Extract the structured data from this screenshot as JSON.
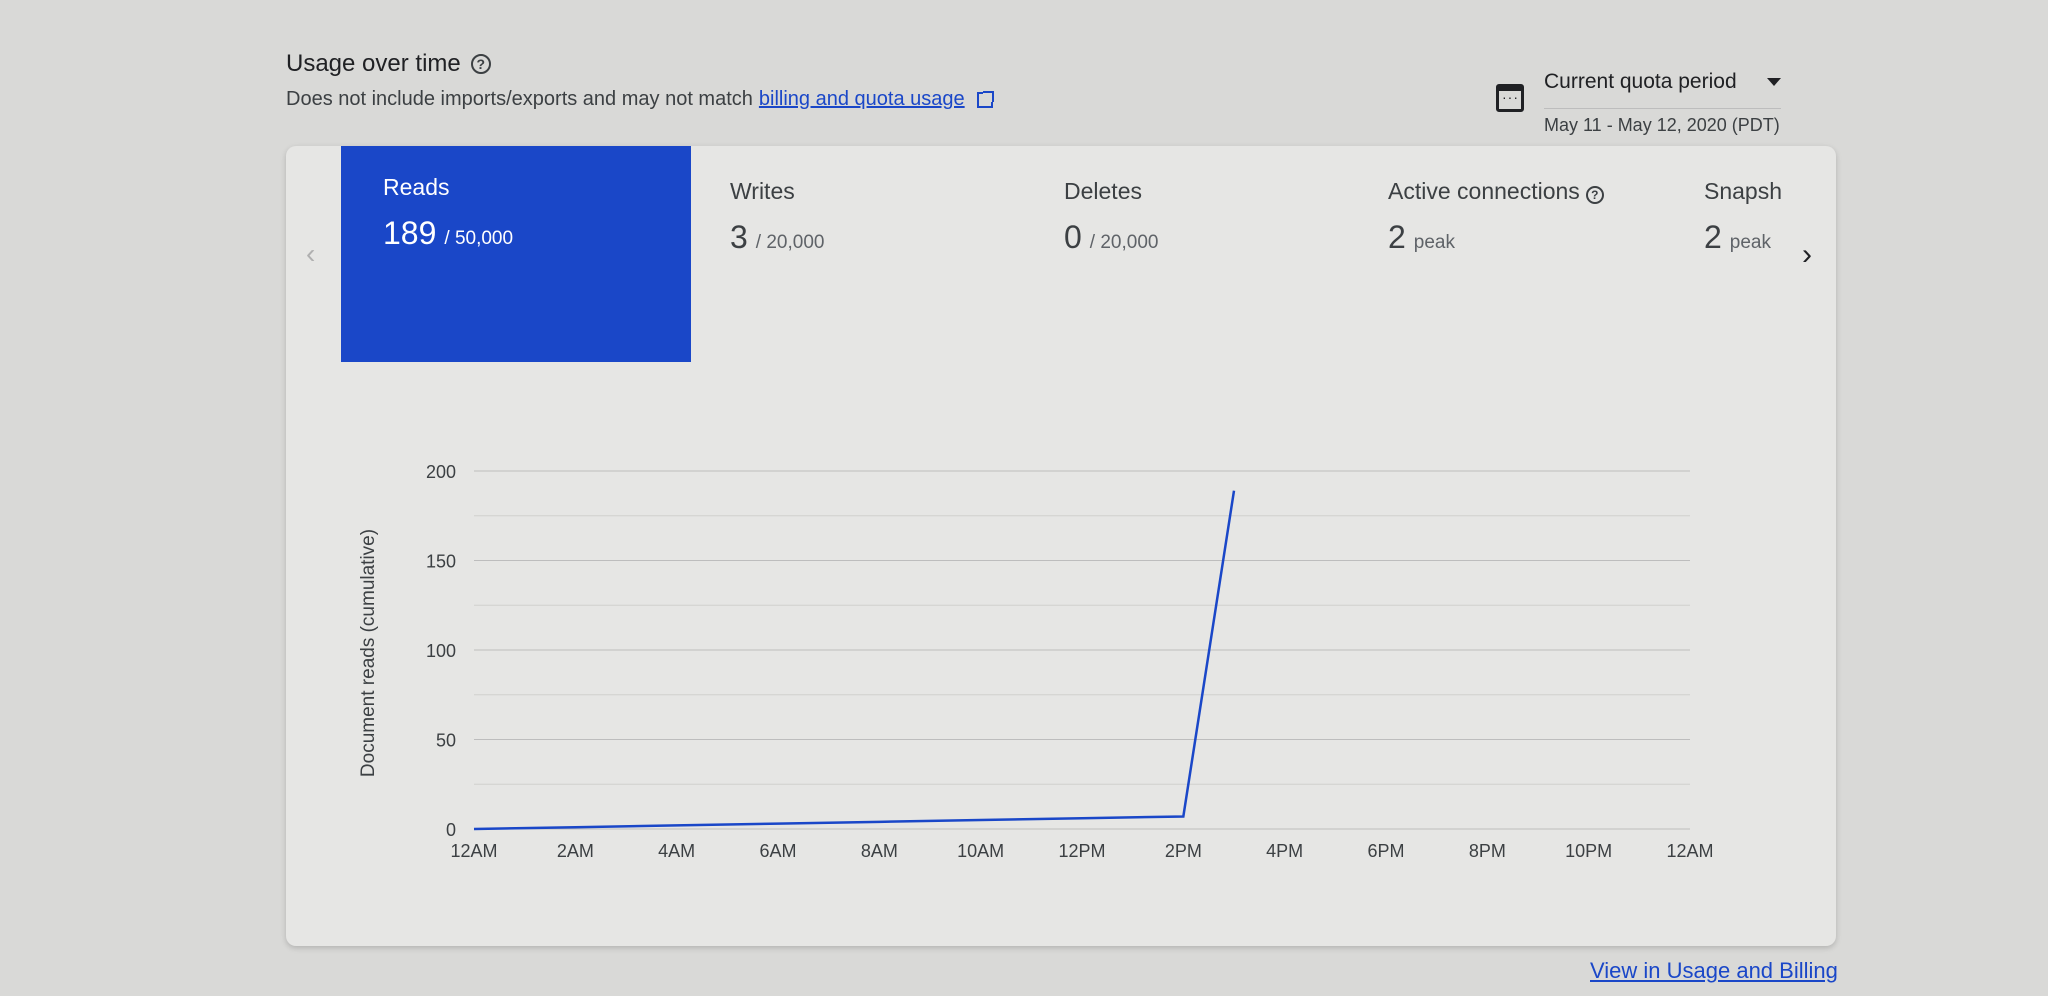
{
  "header": {
    "title": "Usage over time",
    "subtitle": "Does not include imports/exports and may not match",
    "link": "billing and quota usage"
  },
  "period": {
    "selected": "Current quota period",
    "range": "May 11 - May 12, 2020 (PDT)"
  },
  "tabs": [
    {
      "label": "Reads",
      "value": "189",
      "limit": "/ 50,000"
    },
    {
      "label": "Writes",
      "value": "3",
      "limit": "/ 20,000"
    },
    {
      "label": "Deletes",
      "value": "0",
      "limit": "/ 20,000"
    },
    {
      "label": "Active connections",
      "value": "2",
      "limit": "peak"
    },
    {
      "label": "Snapsh",
      "value": "2",
      "limit": "peak"
    }
  ],
  "chart_data": {
    "type": "line",
    "ylabel": "Document reads (cumulative)",
    "xlabel": "",
    "ylim": [
      0,
      200
    ],
    "yticks": [
      "200",
      "150",
      "100",
      "50",
      "0"
    ],
    "xticks": [
      "12AM",
      "2AM",
      "4AM",
      "6AM",
      "8AM",
      "10AM",
      "12PM",
      "2PM",
      "4PM",
      "6PM",
      "8PM",
      "10PM",
      "12AM"
    ],
    "series": [
      {
        "color": "#1a47c8",
        "points": [
          [
            0,
            0
          ],
          [
            2,
            1
          ],
          [
            4,
            2
          ],
          [
            6,
            3
          ],
          [
            8,
            4
          ],
          [
            10,
            5
          ],
          [
            12,
            6
          ],
          [
            14,
            7
          ],
          [
            15,
            189
          ]
        ]
      }
    ],
    "grid": true
  },
  "footer": {
    "link": "View in Usage and Billing"
  }
}
